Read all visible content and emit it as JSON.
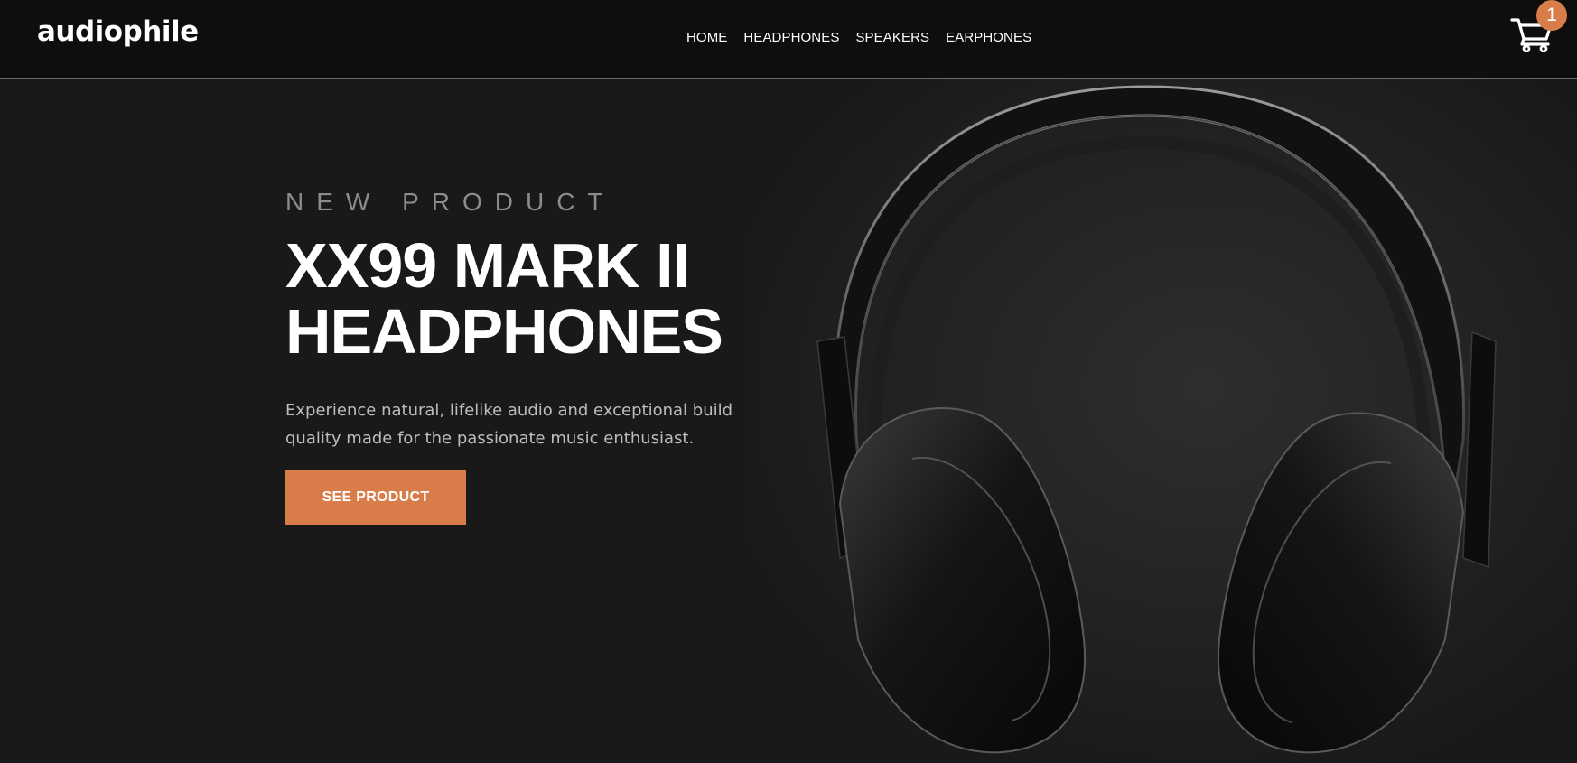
{
  "header": {
    "logo": "audiophile",
    "nav": {
      "home": "HOME",
      "headphones": "HEADPHONES",
      "speakers": "SPEAKERS",
      "earphones": "EARPHONES"
    },
    "cart": {
      "icon": "cart-icon",
      "count": "1"
    }
  },
  "hero": {
    "eyebrow": "NEW PRODUCT",
    "title_line1": "XX99 MARK II",
    "title_line2": "HEADPHONES",
    "description": "Experience natural, lifelike audio and exceptional build quality made for the passionate music enthusiast.",
    "cta_label": "SEE PRODUCT",
    "image": "headphones-image"
  },
  "colors": {
    "accent": "#d87d4a",
    "header_bg": "#0e0e0e",
    "hero_bg": "#191919",
    "text_primary": "#ffffff",
    "text_muted": "#8c8c8c"
  }
}
